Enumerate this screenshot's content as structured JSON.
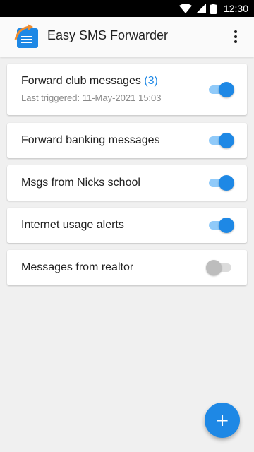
{
  "status_bar": {
    "time": "12:30",
    "icons": [
      "wifi-icon",
      "cell-signal-icon",
      "battery-icon"
    ]
  },
  "app_bar": {
    "title": "Easy SMS Forwarder",
    "logo_icon": "envelope-forward-icon",
    "menu_icon": "more-vert-icon"
  },
  "colors": {
    "accent": "#1e88e5",
    "accent_light": "#90caf9",
    "background": "#f0f0f0",
    "status_bar": "#000000"
  },
  "rules": [
    {
      "title": "Forward club messages",
      "count": "(3)",
      "subtitle": "Last triggered: 11-May-2021 15:03",
      "enabled": true
    },
    {
      "title": "Forward banking messages",
      "enabled": true
    },
    {
      "title": "Msgs from Nicks school",
      "enabled": true
    },
    {
      "title": "Internet usage alerts",
      "enabled": true
    },
    {
      "title": "Messages from realtor",
      "enabled": false
    }
  ],
  "fab": {
    "label": "+",
    "icon": "add-icon"
  }
}
